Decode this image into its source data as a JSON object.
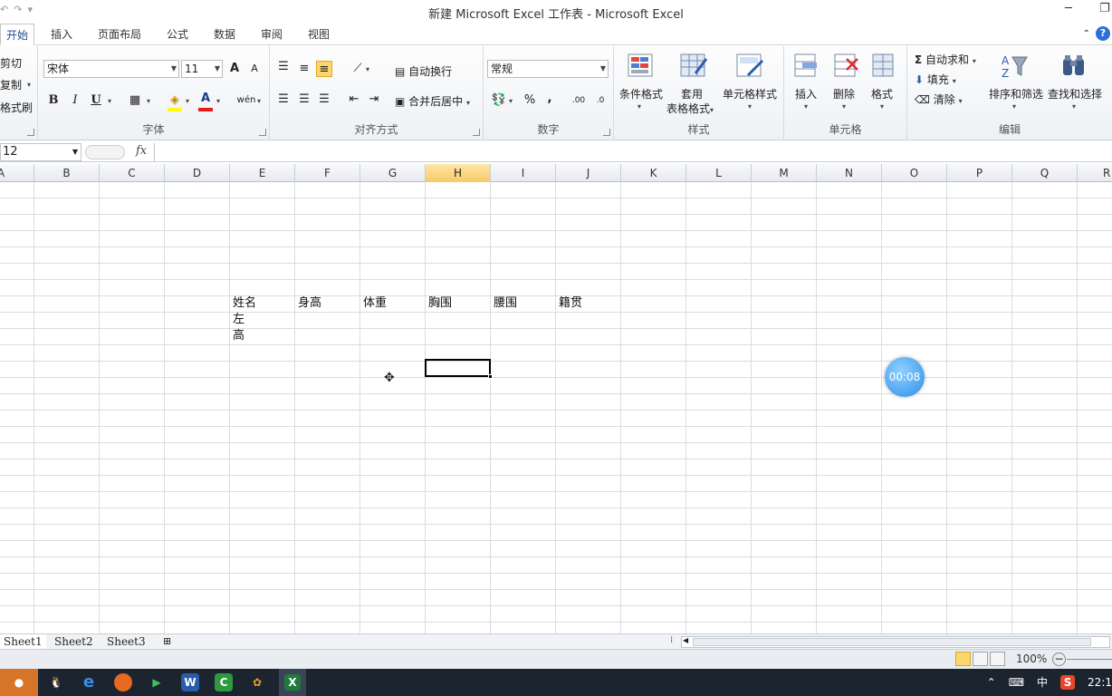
{
  "window": {
    "title": "新建 Microsoft Excel 工作表 - Microsoft Excel",
    "minimize": "─",
    "restore": "❐"
  },
  "quick_access": {
    "undo": "↶",
    "redo": "↷",
    "customize": "▾"
  },
  "tabs": [
    "开始",
    "插入",
    "页面布局",
    "公式",
    "数据",
    "审阅",
    "视图"
  ],
  "ribbon": {
    "clipboard": {
      "cut": "剪切",
      "copy": "复制",
      "format_painter": "格式刷"
    },
    "font": {
      "label": "字体",
      "font_name": "宋体",
      "font_size": "11",
      "grow": "A",
      "shrink": "A",
      "bold": "B",
      "italic": "I",
      "underline": "U",
      "phonetic": "wén"
    },
    "alignment": {
      "label": "对齐方式",
      "wrap_text": "自动换行",
      "merge_center": "合并后居中"
    },
    "number": {
      "label": "数字",
      "format": "常规",
      "percent": "%",
      "comma": ",",
      "inc_decimal": ".00",
      "dec_decimal": ".0"
    },
    "styles": {
      "label": "样式",
      "conditional": "条件格式",
      "table_line1": "套用",
      "table_line2": "表格格式",
      "cell_styles": "单元格样式"
    },
    "cells": {
      "label": "单元格",
      "insert": "插入",
      "delete": "删除",
      "format": "格式"
    },
    "editing": {
      "label": "编辑",
      "autosum": "自动求和",
      "fill": "填充",
      "clear": "清除",
      "sort_filter": "排序和筛选",
      "find_select": "查找和选择"
    }
  },
  "formula_bar": {
    "name_box": "12",
    "fx": "fx"
  },
  "columns": [
    "A",
    "B",
    "C",
    "D",
    "E",
    "F",
    "G",
    "H",
    "I",
    "J",
    "K",
    "L",
    "M",
    "N",
    "O",
    "P",
    "Q",
    "R"
  ],
  "active_column": "H",
  "cells": {
    "header_row": [
      "姓名",
      "身高",
      "体重",
      "胸围",
      "腰围",
      "籍贯"
    ],
    "e_col_row2": "左",
    "e_col_row3": "高"
  },
  "cursor": "✥",
  "timer": "00:08",
  "sheets": [
    "Sheet1",
    "Sheet2",
    "Sheet3"
  ],
  "active_sheet": "Sheet1",
  "status": {
    "zoom": "100%"
  },
  "taskbar": {
    "ime": "中",
    "clock": "22:1"
  },
  "colors": {
    "accent": "#1a4d8f",
    "selected_button": "#fbd66a",
    "timer_blue": "#2d8fe8",
    "taskbar": "#1c2430"
  }
}
